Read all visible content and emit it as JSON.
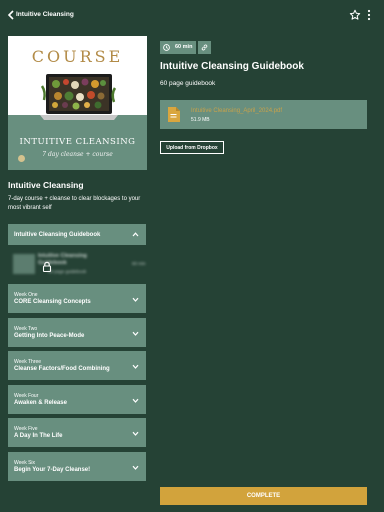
{
  "header": {
    "title": "Intuitive Cleansing",
    "back_icon": "chevron-left-icon",
    "favorite_icon": "star-icon",
    "menu_icon": "kebab-menu-icon"
  },
  "cover": {
    "word": "COURSE",
    "title": "INTUITIVE CLEANSING",
    "subtitle": "7 day cleanse + course"
  },
  "course": {
    "name": "Intuitive Cleansing",
    "description": "7-day course + cleanse to clear blockages to your most vibrant self"
  },
  "sidebar": {
    "open_section": {
      "label": "Intuitive Cleansing Guidebook",
      "lesson": {
        "title": "Intuitive Cleansing Guidebook",
        "subtitle": "60 page guidebook",
        "duration": "60 min",
        "locked": true
      }
    },
    "weeks": [
      {
        "week": "Week One",
        "title": "CORE Cleansing Concepts"
      },
      {
        "week": "Week Two",
        "title": "Getting Into Peace-Mode"
      },
      {
        "week": "Week Three",
        "title": "Cleanse Factors/Food Combining"
      },
      {
        "week": "Week Four",
        "title": "Awaken & Release"
      },
      {
        "week": "Week Five",
        "title": "A Day In The Life"
      },
      {
        "week": "Week Six",
        "title": "Begin Your 7-Day Cleanse!"
      }
    ]
  },
  "main": {
    "duration": "60 min",
    "title": "Intuitive Cleansing Guidebook",
    "meta": "60 page guidebook",
    "file": {
      "name": "Intuitive Cleansing_April_2024.pdf",
      "size": "51.9 MB",
      "icon": "document-icon"
    },
    "upload_label": "Upload from Dropbox",
    "complete_label": "COMPLETE"
  },
  "colors": {
    "background": "#254235",
    "panel": "#688f7f",
    "accent": "#d2a33c",
    "file_link": "#c9a24a"
  }
}
